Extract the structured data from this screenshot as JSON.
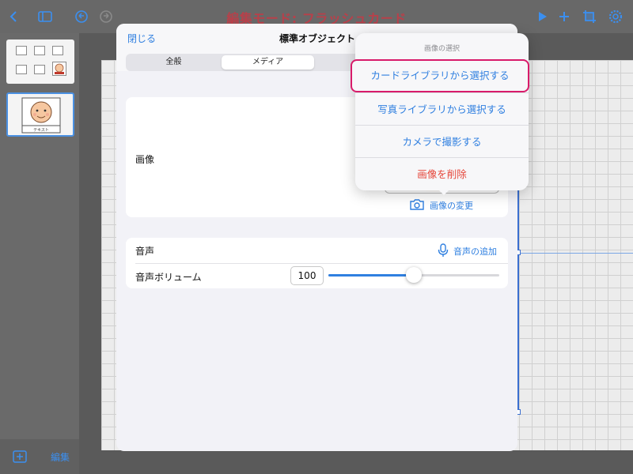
{
  "toolbar": {
    "title": "編集モード: フラッシュカード",
    "icons": [
      "back-chevron-icon",
      "sidebar-toggle-icon",
      "undo-icon",
      "redo-icon",
      "play-icon",
      "add-icon",
      "crop-icon",
      "settings-gear-icon"
    ]
  },
  "sidebar": {
    "thumb2_caption": "テキスト",
    "edit_label": "編集"
  },
  "modal": {
    "close_label": "閉じる",
    "title": "標準オブジェクト",
    "tabs": [
      {
        "label": "全般",
        "active": false
      },
      {
        "label": "メディア",
        "active": true
      }
    ],
    "image_section": {
      "label": "画像",
      "change_label": "画像の変更"
    },
    "audio_section": {
      "label": "音声",
      "add_label": "音声の追加",
      "volume_label": "音声ボリューム",
      "volume_value": "100",
      "slider_fraction": 0.5
    }
  },
  "popover": {
    "title": "画像の選択",
    "items": [
      {
        "label": "カードライブラリから選択する",
        "highlighted": true
      },
      {
        "label": "写真ライブラリから選択する"
      },
      {
        "label": "カメラで撮影する"
      },
      {
        "label": "画像を削除",
        "destructive": true
      }
    ]
  },
  "colors": {
    "accent": "#2f7fe0",
    "title_red": "#b8404a",
    "destructive": "#e5463a",
    "highlight_border": "#d81b6a"
  }
}
